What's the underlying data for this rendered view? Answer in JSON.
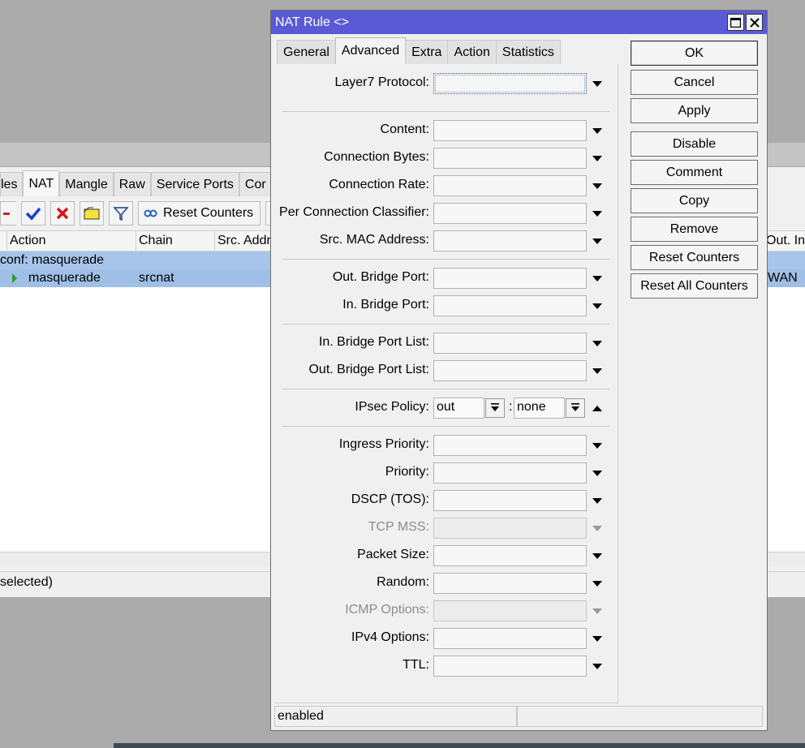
{
  "background": {
    "tabs": [
      "les",
      "NAT",
      "Mangle",
      "Raw",
      "Service Ports",
      "Cor"
    ],
    "active_tab": "NAT",
    "toolbar": {
      "reset_counters_label": "Reset Counters"
    },
    "columns": [
      "Action",
      "Chain",
      "Src. Addr",
      "Out. In"
    ],
    "group_label": "conf: masquerade",
    "row": {
      "action": "masquerade",
      "chain": "srcnat",
      "out_interface": "WAN"
    },
    "status": "selected)"
  },
  "dialog": {
    "title": "NAT Rule <>",
    "tabs": [
      "General",
      "Advanced",
      "Extra",
      "Action",
      "Statistics"
    ],
    "active_tab": "Advanced",
    "fields": {
      "layer7_protocol": {
        "label": "Layer7 Protocol:",
        "value": ""
      },
      "content": {
        "label": "Content:",
        "value": ""
      },
      "connection_bytes": {
        "label": "Connection Bytes:",
        "value": ""
      },
      "connection_rate": {
        "label": "Connection Rate:",
        "value": ""
      },
      "per_connection_classifier": {
        "label": "Per Connection Classifier:",
        "value": ""
      },
      "src_mac_address": {
        "label": "Src. MAC Address:",
        "value": ""
      },
      "out_bridge_port": {
        "label": "Out. Bridge Port:",
        "value": ""
      },
      "in_bridge_port": {
        "label": "In. Bridge Port:",
        "value": ""
      },
      "in_bridge_port_list": {
        "label": "In. Bridge Port List:",
        "value": ""
      },
      "out_bridge_port_list": {
        "label": "Out. Bridge Port List:",
        "value": ""
      },
      "ipsec_policy": {
        "label": "IPsec Policy:",
        "direction": "out",
        "policy": "none",
        "separator": ":"
      },
      "ingress_priority": {
        "label": "Ingress Priority:",
        "value": ""
      },
      "priority": {
        "label": "Priority:",
        "value": ""
      },
      "dscp": {
        "label": "DSCP (TOS):",
        "value": ""
      },
      "tcp_mss": {
        "label": "TCP MSS:",
        "value": ""
      },
      "packet_size": {
        "label": "Packet Size:",
        "value": ""
      },
      "random": {
        "label": "Random:",
        "value": ""
      },
      "icmp_options": {
        "label": "ICMP Options:",
        "value": ""
      },
      "ipv4_options": {
        "label": "IPv4 Options:",
        "value": ""
      },
      "ttl": {
        "label": "TTL:",
        "value": ""
      }
    },
    "buttons": {
      "ok": "OK",
      "cancel": "Cancel",
      "apply": "Apply",
      "disable": "Disable",
      "comment": "Comment",
      "copy": "Copy",
      "remove": "Remove",
      "reset_counters": "Reset Counters",
      "reset_all_counters": "Reset All Counters"
    },
    "status": {
      "state": "enabled",
      "extra": ""
    }
  },
  "colors": {
    "titlebar": "#5a5ad6",
    "selection": "#a0bfe6",
    "desktop": "#ababab"
  }
}
